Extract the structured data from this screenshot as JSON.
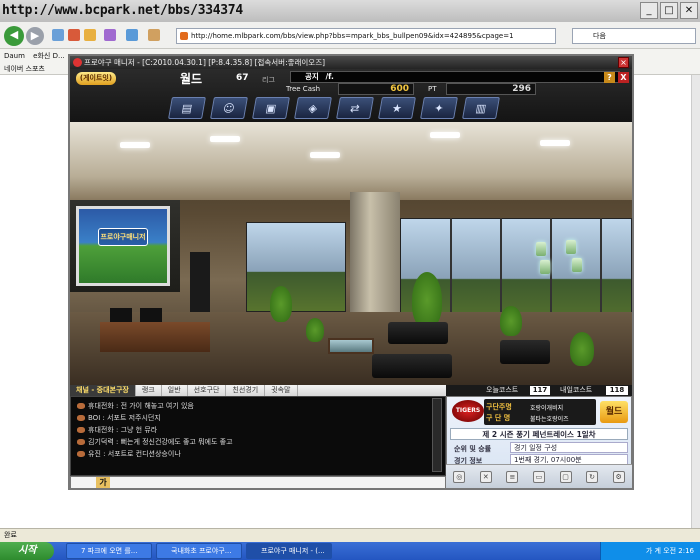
{
  "browser": {
    "watermark": "http://www.bcpark.net/bbs/334374",
    "address": "http://home.mlbpark.com/bbs/view.php?bbs=mpark_bbs_bullpen09&idx=424895&cpage=1",
    "search_label": "다음",
    "bookmarks": [
      "Daum",
      "e화신 D..."
    ],
    "linkbar_label": "네이버 스포츠",
    "status": "완료"
  },
  "game": {
    "title": "프로야구 매니저 - [C:2010.04.30.1] [P:8.4.35.8] [접속서버:좋래이오즈]",
    "season_button": "(게이트잇)",
    "league_name": "월드",
    "rank": "67",
    "league_suffix": "리그",
    "notice_label": "공지",
    "notice_text": "/f.",
    "cash_label": "Tree Cash",
    "cash_value": "600",
    "pt_label": "PT",
    "pt_value": "296",
    "help_label": "?",
    "close_label": "X",
    "menu_icons": [
      "roster-icon",
      "coach-icon",
      "tv-icon",
      "stadium-icon",
      "trade-icon",
      "league-icon",
      "shop-icon",
      "book-icon"
    ],
    "projector_text": "프로야구매니저"
  },
  "tabs": [
    {
      "label": "채널 - 중대본구장",
      "channel": true
    },
    {
      "label": "랭크"
    },
    {
      "label": "일반"
    },
    {
      "label": "선호구단"
    },
    {
      "label": "친선경기"
    },
    {
      "label": "귓속말"
    }
  ],
  "chat": [
    "휴대전화 : 전 가이 해놓고 여기 있음",
    "BOI : 서포트 저주시던지",
    "휴대전화 : 그냥 헌 뮤라",
    "김기덕력 : 뻐는게 정신건강에도 좋고 뭐에도 좋고",
    "유진 : 서포트로 컨디션상승이나"
  ],
  "today": {
    "label1": "오늘코스트",
    "value1": "117",
    "label2": "내일코스트",
    "value2": "118"
  },
  "team": {
    "logo_text": "TIGERS",
    "row1_label": "구단주명",
    "row1_value": "호랑이개비지",
    "row2_label": "구 단 명",
    "row2_value": "불타는호랑이즈",
    "badge": "월드",
    "season_title": "제 2 시즌 풍기 페넌트레이스 1일차",
    "rank_label": "순위 및 승률",
    "rank_value": "경기 일정 구성",
    "game_label": "경기 정보",
    "game_value": "1번째 경기, 07시00분"
  },
  "taskbar": {
    "start": "시작",
    "tasks": [
      "7 파크에 오면 를...",
      "국내화초 프로야구...",
      "프로야구 매니저 - (..."
    ],
    "tray": "가 계  오전 2:16"
  }
}
